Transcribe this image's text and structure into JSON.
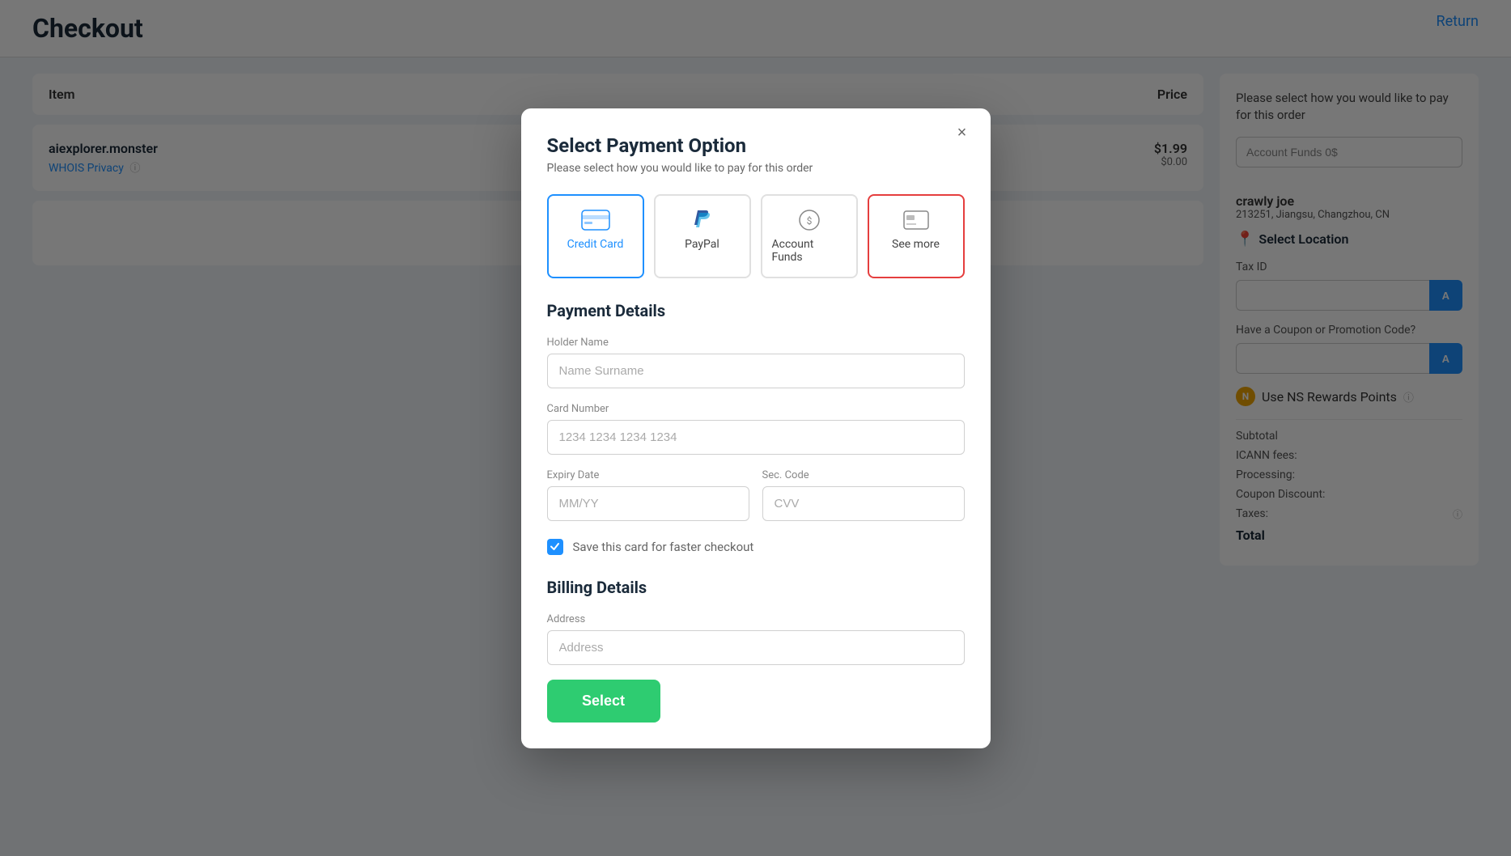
{
  "page": {
    "title": "Checkout",
    "return_link": "Return"
  },
  "table": {
    "col_item": "Item",
    "col_price": "Price"
  },
  "items": [
    {
      "name": "aiexplorer.monster",
      "sub": "WHOIS Privacy",
      "price_main": "$1.99",
      "price_sub": "$0.00"
    }
  ],
  "sidebar": {
    "title": "Please select how you would like to pay for this order",
    "account_funds_label": "Account Funds 0$",
    "customer_name": "crawly joe",
    "customer_address": "213251, Jiangsu, Changzhou, CN",
    "select_location_label": "Select Location",
    "tax_id_label": "Tax ID",
    "coupon_label": "Have a Coupon or Promotion Code?",
    "rewards_label": "Use NS Rewards Points",
    "subtotal_label": "Subtotal",
    "icann_label": "ICANN fees:",
    "processing_label": "Processing:",
    "coupon_discount_label": "Coupon Discount:",
    "taxes_label": "Taxes:",
    "total_label": "Total"
  },
  "modal": {
    "title": "Select Payment Option",
    "subtitle": "Please select how you would like to pay for this order",
    "close_label": "×",
    "payment_options": [
      {
        "id": "credit-card",
        "label": "Credit Card",
        "selected": true
      },
      {
        "id": "paypal",
        "label": "PayPal",
        "selected": false
      },
      {
        "id": "account-funds",
        "label": "Account Funds",
        "selected": false
      },
      {
        "id": "see-more",
        "label": "See more",
        "selected": false,
        "highlighted": true
      }
    ],
    "payment_details_title": "Payment Details",
    "holder_name_label": "Holder Name",
    "holder_name_placeholder": "Name Surname",
    "card_number_label": "Card Number",
    "card_number_placeholder": "1234 1234 1234 1234",
    "expiry_label": "Expiry Date",
    "expiry_placeholder": "MM/YY",
    "sec_code_label": "Sec. Code",
    "sec_code_placeholder": "CVV",
    "save_card_label": "Save this card for faster checkout",
    "billing_title": "Billing Details",
    "address_label": "Address",
    "address_placeholder": "Address",
    "select_button_label": "Select"
  }
}
